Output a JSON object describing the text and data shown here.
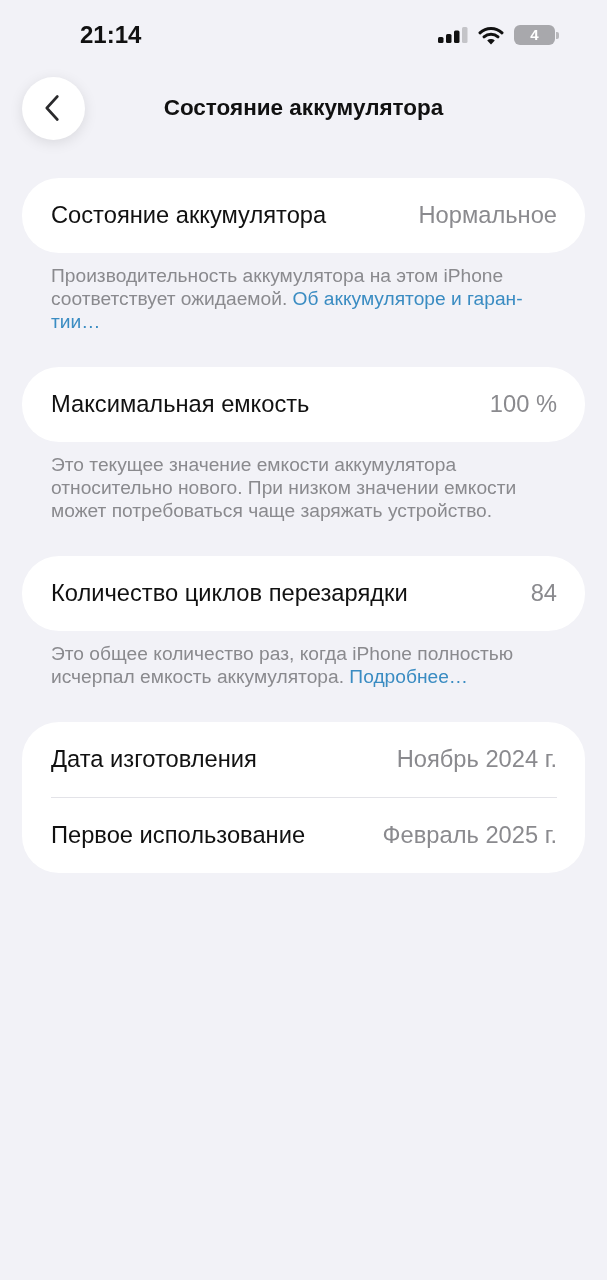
{
  "status_bar": {
    "time": "21:14",
    "battery": "4"
  },
  "nav": {
    "title": "Состояние аккумулятора"
  },
  "sections": [
    {
      "rows": [
        {
          "label": "Состояние аккумулятора",
          "value": "Нормальное"
        }
      ],
      "footnote": {
        "text": "Производительность аккумулятора на этом iPhone соответствует ожидаемой.",
        "link": [
          "Об аккумуляторе и гаран-",
          "тии…"
        ]
      }
    },
    {
      "rows": [
        {
          "label": "Максимальная емкость",
          "value": "100 %"
        }
      ],
      "footnote": {
        "text": "Это текущее значение емкости аккумулятора относительно нового. При низком значении емкости может потребоваться чаще заряжать устройство."
      }
    },
    {
      "rows": [
        {
          "label": "Количество циклов перезарядки",
          "value": "84"
        }
      ],
      "footnote": {
        "text": "Это общее количество раз, когда iPhone полностью исчерпал емкость аккумулятора.",
        "link": [
          "Подробнее…"
        ]
      }
    },
    {
      "rows": [
        {
          "label": "Дата изготовления",
          "value": "Ноябрь 2024 г."
        },
        {
          "label": "Первое использование",
          "value": "Февраль 2025 г."
        }
      ]
    }
  ]
}
